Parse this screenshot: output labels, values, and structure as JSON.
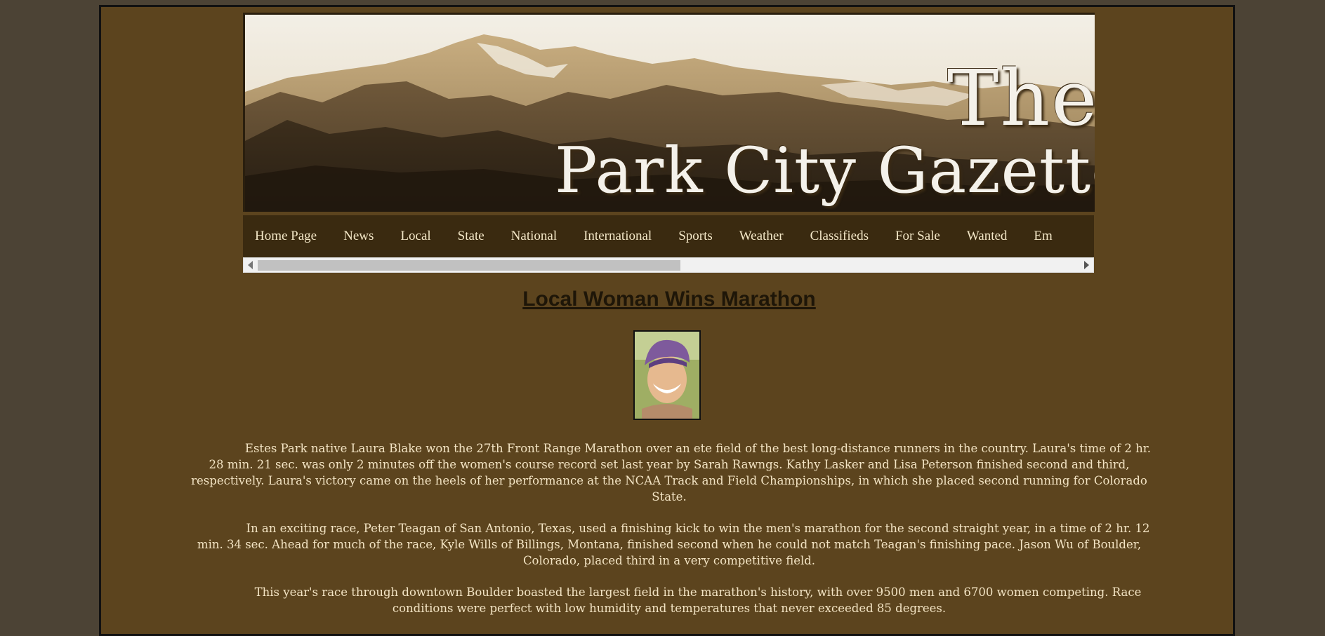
{
  "banner": {
    "the": "The",
    "name": "Park City Gazette"
  },
  "nav": {
    "items": [
      "Home Page",
      "News",
      "Local",
      "State",
      "National",
      "International",
      "Sports",
      "Weather",
      "Classifieds",
      "For Sale",
      "Wanted",
      "Em"
    ]
  },
  "scrollbar": {
    "position_fraction": 0.0,
    "visible_fraction": 0.42
  },
  "article": {
    "headline": "Local Woman Wins Marathon",
    "paragraphs": [
      "Estes Park native Laura Blake won the 27th Front Range Marathon over an ete field of the best long-distance runners in the country. Laura's time of 2 hr. 28 min. 21 sec. was only 2 minutes off the women's course record set last year by Sarah Rawngs. Kathy Lasker and Lisa Peterson finished second and third, respectively. Laura's victory came on the heels of her performance at the NCAA Track and Field Championships, in which she placed second running for Colorado State.",
      "In an exciting race, Peter Teagan of San Antonio, Texas, used a finishing kick to win the men's marathon for the second straight year, in a time of 2 hr. 12 min. 34 sec. Ahead for much of the race, Kyle Wills of Billings, Montana, finished second when he could not match Teagan's finishing pace. Jason Wu of Boulder, Colorado, placed third in a very competitive field.",
      "This year's race through downtown Boulder boasted the largest field in the marathon's history, with over 9500 men and 6700 women competing. Race conditions were perfect with low humidity and temperatures that never exceeded 85 degrees."
    ]
  },
  "colors": {
    "outer_background": "#4c4335",
    "page_background": "#5c441e",
    "nav_background": "#3a2a10",
    "nav_text": "#f4e8c8",
    "headline": "#1e1608",
    "body_text": "#f3e4c4"
  },
  "icons": {
    "scroll_left": "triangle-left",
    "scroll_right": "triangle-right"
  }
}
